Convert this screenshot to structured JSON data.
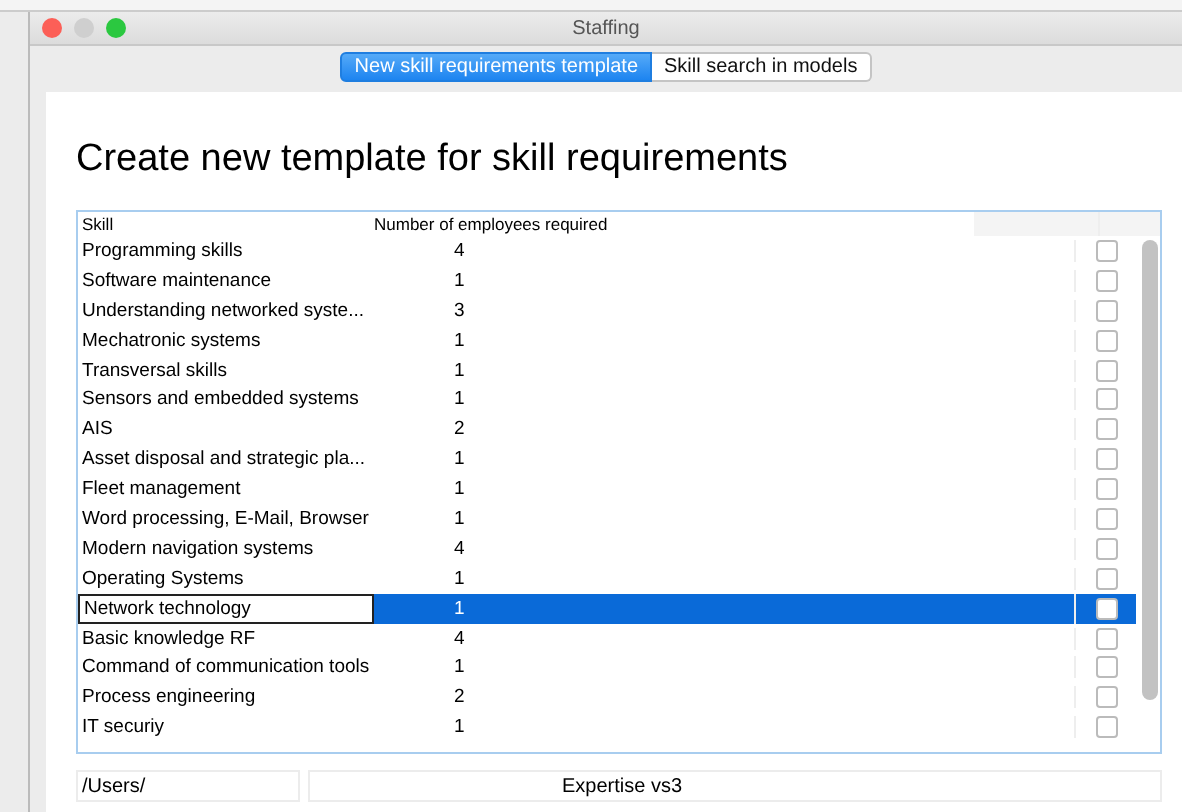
{
  "window": {
    "title": "Staffing"
  },
  "tabs": [
    {
      "label": "New skill requirements template",
      "selected": true
    },
    {
      "label": "Skill search in models",
      "selected": false
    }
  ],
  "heading": "Create new template for skill requirements",
  "table": {
    "columns": [
      "Skill",
      "Number of employees required"
    ],
    "rows": [
      {
        "skill": "Programming skills",
        "count": "4",
        "checked": false,
        "selected": false
      },
      {
        "skill": "Software maintenance",
        "count": "1",
        "checked": false,
        "selected": false
      },
      {
        "skill": "Understanding networked syste...",
        "count": "3",
        "checked": false,
        "selected": false
      },
      {
        "skill": "Mechatronic systems",
        "count": "1",
        "checked": false,
        "selected": false
      },
      {
        "skill": "Transversal skills",
        "count": "1",
        "checked": false,
        "selected": false
      },
      {
        "skill": "Sensors and embedded systems",
        "count": "1",
        "checked": false,
        "selected": false
      },
      {
        "skill": "AIS",
        "count": "2",
        "checked": false,
        "selected": false
      },
      {
        "skill": "Asset disposal and strategic pla...",
        "count": "1",
        "checked": false,
        "selected": false
      },
      {
        "skill": "Fleet management",
        "count": "1",
        "checked": false,
        "selected": false
      },
      {
        "skill": "Word processing, E-Mail, Browser",
        "count": "1",
        "checked": false,
        "selected": false
      },
      {
        "skill": "Modern navigation systems",
        "count": "4",
        "checked": false,
        "selected": false
      },
      {
        "skill": "Operating Systems",
        "count": "1",
        "checked": false,
        "selected": false
      },
      {
        "skill": "Network technology",
        "count": "1",
        "checked": false,
        "selected": true
      },
      {
        "skill": "Basic knowledge RF",
        "count": "4",
        "checked": false,
        "selected": false
      },
      {
        "skill": "Command of communication tools",
        "count": "1",
        "checked": false,
        "selected": false
      },
      {
        "skill": "Process engineering",
        "count": "2",
        "checked": false,
        "selected": false
      },
      {
        "skill": "IT securiy",
        "count": "1",
        "checked": false,
        "selected": false
      }
    ]
  },
  "path_field": {
    "value": "/Users/"
  },
  "name_field": {
    "value": "Expertise vs3"
  }
}
